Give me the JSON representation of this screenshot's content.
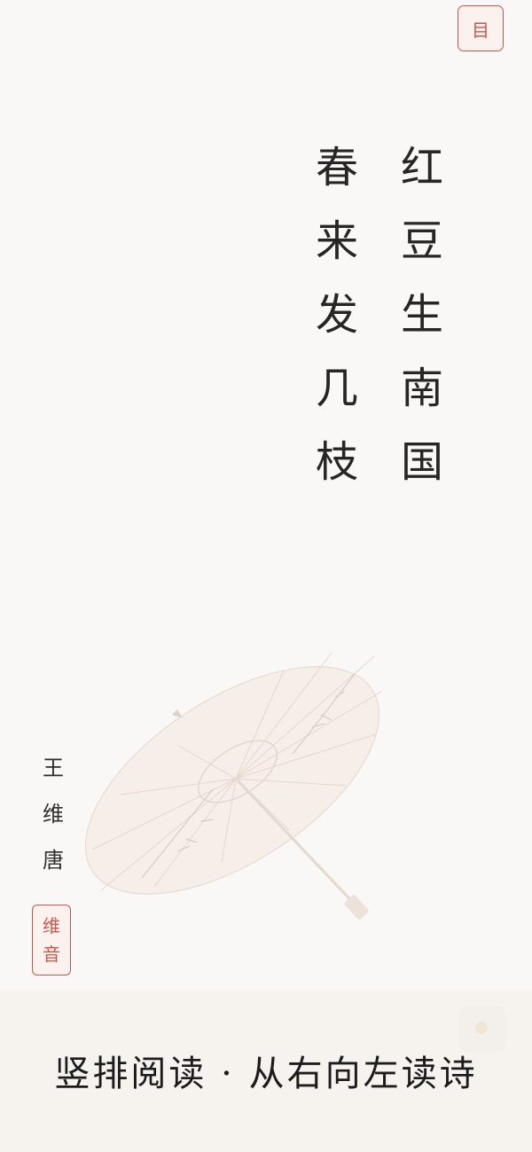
{
  "menu_icon": {
    "glyph": "目",
    "name": "list-icon"
  },
  "poem": {
    "line1": [
      "红",
      "豆",
      "生",
      "南",
      "国"
    ],
    "line2": [
      "春",
      "来",
      "发",
      "几",
      "枝"
    ]
  },
  "author": {
    "name": [
      "王",
      "维"
    ],
    "dynasty": "唐"
  },
  "seal": [
    "维",
    "音"
  ],
  "caption": "竖排阅读 · 从右向左读诗",
  "colors": {
    "background": "#faf8f6",
    "text": "#262626",
    "seal_red": "#c8574a",
    "caption_bar": "#f6f3ee"
  }
}
